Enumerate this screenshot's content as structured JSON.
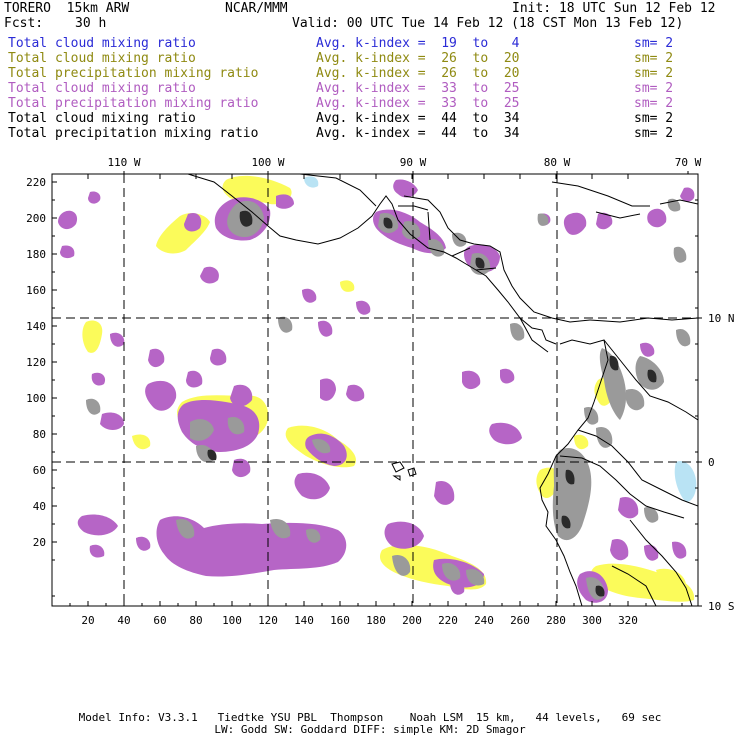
{
  "header": {
    "model": "TORERO  15km ARW",
    "center": "NCAR/MMM",
    "init": "Init: 18 UTC Sun 12 Feb 12",
    "fcst_label": "Fcst:",
    "fcst_value": "30 h",
    "valid": "Valid: 00 UTC Tue 14 Feb 12 (18 CST Mon 13 Feb 12)"
  },
  "legend": [
    {
      "field": "Total cloud mixing ratio",
      "index": "Avg. k-index =  19  to   4",
      "sm": "sm= 2",
      "color": "#2b2bd6"
    },
    {
      "field": "Total cloud mixing ratio",
      "index": "Avg. k-index =  26  to  20",
      "sm": "sm= 2",
      "color": "#8f8a12"
    },
    {
      "field": "Total precipitation mixing ratio",
      "index": "Avg. k-index =  26  to  20",
      "sm": "sm= 2",
      "color": "#8f8a12"
    },
    {
      "field": "Total cloud mixing ratio",
      "index": "Avg. k-index =  33  to  25",
      "sm": "sm= 2",
      "color": "#b05cc0"
    },
    {
      "field": "Total precipitation mixing ratio",
      "index": "Avg. k-index =  33  to  25",
      "sm": "sm= 2",
      "color": "#b05cc0"
    },
    {
      "field": "Total cloud mixing ratio",
      "index": "Avg. k-index =  44  to  34",
      "sm": "sm= 2",
      "color": "#000000"
    },
    {
      "field": "Total precipitation mixing ratio",
      "index": "Avg. k-index =  44  to  34",
      "sm": "sm= 2",
      "color": "#000000"
    }
  ],
  "map": {
    "lon_labels": [
      "110 W",
      "100 W",
      "90 W",
      "80 W",
      "70 W"
    ],
    "lat_labels": [
      "10 N",
      "0",
      "10 S"
    ],
    "y_ticks": [
      "220",
      "200",
      "180",
      "160",
      "140",
      "120",
      "100",
      "80",
      "60",
      "40",
      "20"
    ],
    "x_ticks": [
      "20",
      "40",
      "60",
      "80",
      "100",
      "120",
      "140",
      "160",
      "180",
      "200",
      "220",
      "240",
      "260",
      "280",
      "300",
      "320"
    ],
    "colors": {
      "blue_field": "#b9e3f4",
      "yellow_field": "#fbfb5a",
      "purple_field": "#b665c6",
      "gray_field": "#9a9a9a",
      "black_field": "#2a2a2a",
      "coast": "#000000"
    }
  },
  "footer": {
    "line1": "Model Info: V3.3.1   Tiedtke YSU PBL  Thompson    Noah LSM  15 km,   44 levels,   69 sec",
    "line2": "LW: Godd SW: Goddard DIFF: simple KM: 2D Smagor"
  }
}
